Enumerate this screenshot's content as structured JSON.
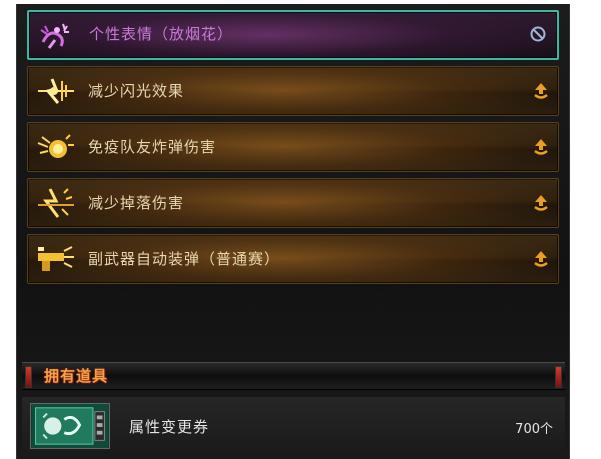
{
  "skills": [
    {
      "label": "个性表情（放烟花）",
      "icon": "fireworks-icon",
      "status": "disabled",
      "status_icon": "prohibited-icon",
      "active": true
    },
    {
      "label": "减少闪光效果",
      "icon": "flash-reduce-icon",
      "status": "upgrade",
      "status_icon": "upgrade-arrow-icon",
      "active": false
    },
    {
      "label": "免疫队友炸弹伤害",
      "icon": "bomb-immune-icon",
      "status": "upgrade",
      "status_icon": "upgrade-arrow-icon",
      "active": false
    },
    {
      "label": "减少掉落伤害",
      "icon": "fall-damage-icon",
      "status": "upgrade",
      "status_icon": "upgrade-arrow-icon",
      "active": false
    },
    {
      "label": "副武器自动装弹（普通赛）",
      "icon": "auto-reload-icon",
      "status": "upgrade",
      "status_icon": "upgrade-arrow-icon",
      "active": false
    }
  ],
  "inventory": {
    "title": "拥有道具",
    "items": [
      {
        "name": "属性变更券",
        "count": "700个",
        "icon": "attribute-change-ticket-icon"
      }
    ]
  },
  "colors": {
    "active_border": "#3cb7a2",
    "active_label": "#c87ad6",
    "label": "#e8d7b0",
    "upgrade_icon": "#e8a020",
    "title_accent": "#f0a24a"
  }
}
